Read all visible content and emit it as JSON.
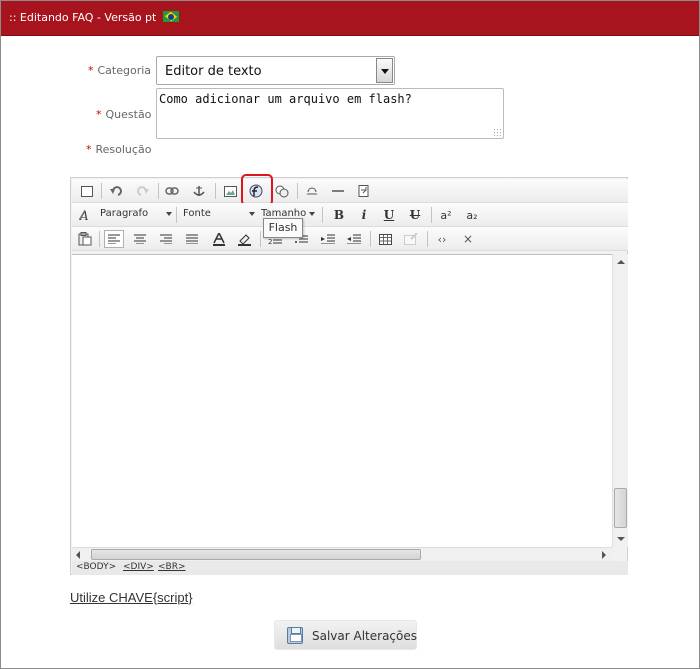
{
  "window": {
    "title": ":: Editando FAQ - Versão pt",
    "flag_icon": "brazil-flag-icon"
  },
  "form": {
    "categoria": {
      "label": "Categoria",
      "required_mark": "*",
      "value": "Editor de texto"
    },
    "questao": {
      "label": "Questão",
      "required_mark": "*",
      "value": "Como adicionar um arquivo em flash?"
    },
    "resolucao": {
      "label": "Resolução",
      "required_mark": "*"
    }
  },
  "editor": {
    "format_combo": "Paragrafo",
    "font_combo": "Fonte",
    "size_combo": "Tamanho",
    "bold": "B",
    "italic": "i",
    "underline": "U",
    "strike": "U",
    "superscript": "a²",
    "subscript": "a₂",
    "tooltip": "Flash",
    "highlighted_button": "flash-icon",
    "status_path": [
      "<BODY>",
      "<DIV>",
      "<BR>"
    ],
    "colors": {
      "highlight": "#e0151b"
    }
  },
  "footer": {
    "link": "Utilize CHAVE{script}",
    "save_label": "Salvar Alterações"
  },
  "theme": {
    "titlebar": "#a8141d",
    "required": "#cc0000"
  }
}
